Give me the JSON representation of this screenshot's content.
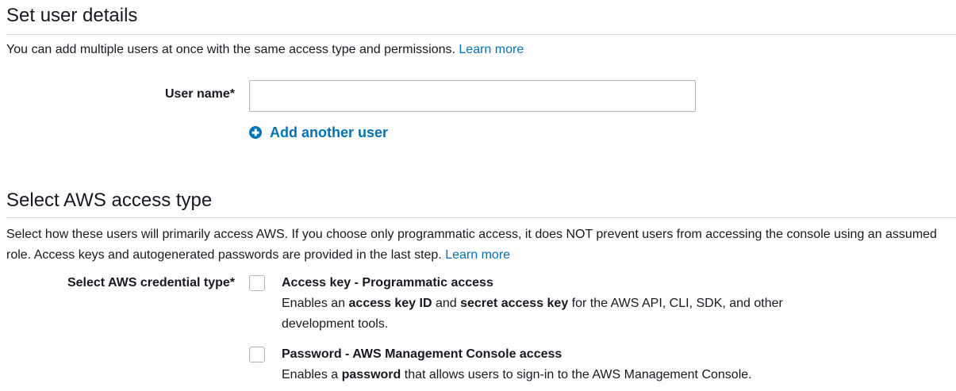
{
  "user_details": {
    "title": "Set user details",
    "description": "You can add multiple users at once with the same access type and permissions.",
    "learn_more": "Learn more",
    "user_name_label": "User name*",
    "user_name_value": "",
    "add_another_user": "Add another user"
  },
  "access_type": {
    "title": "Select AWS access type",
    "description": "Select how these users will primarily access AWS. If you choose only programmatic access, it does NOT prevent users from accessing the console using an assumed role. Access keys and autogenerated passwords are provided in the last step.",
    "learn_more": "Learn more",
    "credential_label": "Select AWS credential type*",
    "options": [
      {
        "title": "Access key - Programmatic access",
        "checked": false,
        "desc_1": "Enables an ",
        "desc_bold_1": "access key ID",
        "desc_2": " and ",
        "desc_bold_2": "secret access key",
        "desc_3": " for the AWS API, CLI, SDK, and other development tools."
      },
      {
        "title": "Password - AWS Management Console access",
        "checked": false,
        "desc_1": "Enables a ",
        "desc_bold_1": "password",
        "desc_2": " that allows users to sign-in to the AWS Management Console."
      }
    ]
  },
  "colors": {
    "link": "#0073bb",
    "text": "#16191f",
    "border": "#aab7b8",
    "rule": "#d5dbdb"
  },
  "icons": {
    "add_user": "plus-circle-icon"
  }
}
